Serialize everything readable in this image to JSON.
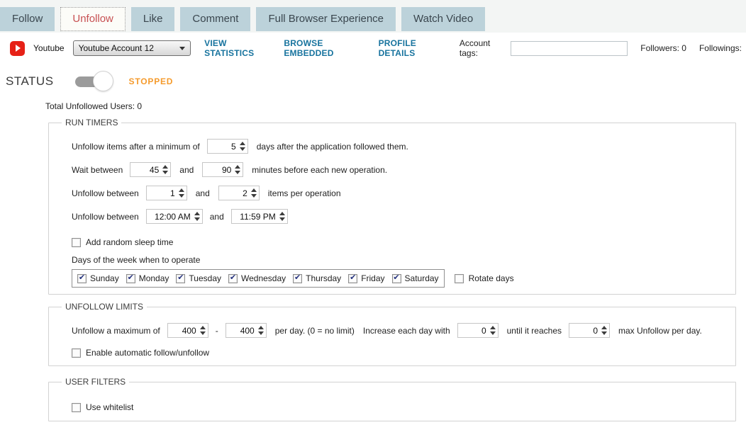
{
  "tabs": [
    {
      "label": "Follow",
      "active": false
    },
    {
      "label": "Unfollow",
      "active": true
    },
    {
      "label": "Like",
      "active": false
    },
    {
      "label": "Comment",
      "active": false
    },
    {
      "label": "Full Browser Experience",
      "active": false
    },
    {
      "label": "Watch Video",
      "active": false
    }
  ],
  "account_bar": {
    "platform_label": "Youtube",
    "account_select_value": "Youtube Account 12",
    "links": {
      "view_statistics": "VIEW STATISTICS",
      "browse_embedded": "BROWSE EMBEDDED",
      "profile_details": "PROFILE DETAILS"
    },
    "account_tags_label": "Account tags:",
    "account_tags_value": "",
    "followers_label": "Followers: 0",
    "followings_label": "Followings:"
  },
  "status": {
    "label": "STATUS",
    "state_text": "STOPPED",
    "toggle_state": "off"
  },
  "summary": {
    "total_unfollowed": "Total Unfollowed Users: 0"
  },
  "run_timers": {
    "legend": "RUN TIMERS",
    "row_min_days": {
      "prefix": "Unfollow items after a minimum of",
      "value": "5",
      "suffix": "days after the application followed them."
    },
    "row_wait": {
      "prefix": "Wait between",
      "min": "45",
      "and": "and",
      "max": "90",
      "suffix": "minutes before each new operation."
    },
    "row_items": {
      "prefix": "Unfollow between",
      "min": "1",
      "and": "and",
      "max": "2",
      "suffix": "items per operation"
    },
    "row_hours": {
      "prefix": "Unfollow between",
      "start": "12:00 AM",
      "and": "and",
      "end": "11:59 PM"
    },
    "add_random_sleep": {
      "label": "Add random sleep time",
      "checked": false
    },
    "days_title": "Days of the week when to operate",
    "days": [
      "Sunday",
      "Monday",
      "Tuesday",
      "Wednesday",
      "Thursday",
      "Friday",
      "Saturday"
    ],
    "days_checked": [
      true,
      true,
      true,
      true,
      true,
      true,
      true
    ],
    "rotate_days": {
      "label": "Rotate days",
      "checked": false
    }
  },
  "unfollow_limits": {
    "legend": "UNFOLLOW LIMITS",
    "row": {
      "prefix": "Unfollow a maximum of",
      "min": "400",
      "dash": "-",
      "max": "400",
      "mid": "per day. (0 = no limit)",
      "increase_label": "Increase each day with",
      "increase_value": "0",
      "until_label": "until it reaches",
      "until_value": "0",
      "suffix": "max Unfollow per day."
    },
    "auto_follow": {
      "label": "Enable automatic follow/unfollow",
      "checked": false
    }
  },
  "user_filters": {
    "legend": "USER FILTERS",
    "whitelist": {
      "label": "Use whitelist",
      "checked": false
    }
  },
  "colors": {
    "tab_bg": "#bcd2da",
    "active_tab_text": "#c75052",
    "link_blue": "#17739e",
    "stopped_orange": "#f59b2d",
    "youtube_red": "#e62117"
  }
}
